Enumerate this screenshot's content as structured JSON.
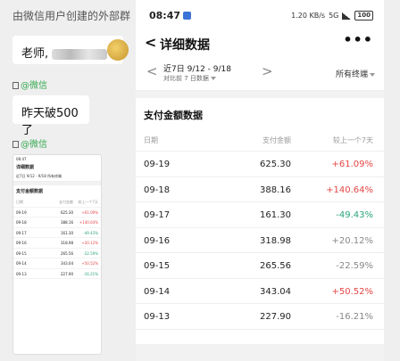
{
  "chat": {
    "header": "由微信用户创建的外部群",
    "msg1": "老师,",
    "source_label": "@微信",
    "msg2": "昨天破500了"
  },
  "thumbnail": {
    "time": "08:47",
    "title": "详细数据",
    "range": "近7日 9/12 - 9/18",
    "terminal": "所有终端",
    "section": "支付金额数据",
    "head": [
      "日期",
      "支付金额",
      "较上一个7天"
    ],
    "rows": [
      [
        "09-19",
        "625.30",
        "+61.09%"
      ],
      [
        "09-18",
        "388.16",
        "+140.64%"
      ],
      [
        "09-17",
        "161.30",
        "-49.43%"
      ],
      [
        "09-16",
        "318.98",
        "+20.12%"
      ],
      [
        "09-15",
        "265.56",
        "-22.59%"
      ],
      [
        "09-14",
        "343.04",
        "+50.52%"
      ],
      [
        "09-13",
        "227.90",
        "-16.21%"
      ]
    ]
  },
  "status": {
    "time": "08:47",
    "speed": "1.20 KB/s",
    "net": "5G",
    "battery": "100"
  },
  "nav": {
    "back": "<",
    "title": "详细数据",
    "more": "•••"
  },
  "range": {
    "prev": "<",
    "next": ">",
    "main": "近7日 9/12 - 9/18",
    "compare": "对比前 7 日数据",
    "terminal": "所有终端"
  },
  "card": {
    "title": "支付金额数据",
    "columns": [
      "日期",
      "支付金额",
      "较上一个7天"
    ],
    "rows": [
      {
        "date": "09-19",
        "amount": "625.30",
        "change": "+61.09%",
        "trend": "up"
      },
      {
        "date": "09-18",
        "amount": "388.16",
        "change": "+140.64%",
        "trend": "up"
      },
      {
        "date": "09-17",
        "amount": "161.30",
        "change": "-49.43%",
        "trend": "down"
      },
      {
        "date": "09-16",
        "amount": "318.98",
        "change": "+20.12%",
        "trend": "neutral"
      },
      {
        "date": "09-15",
        "amount": "265.56",
        "change": "-22.59%",
        "trend": "neutral"
      },
      {
        "date": "09-14",
        "amount": "343.04",
        "change": "+50.52%",
        "trend": "up"
      },
      {
        "date": "09-13",
        "amount": "227.90",
        "change": "-16.21%",
        "trend": "neutral"
      }
    ]
  },
  "colors": {
    "up": "#e64545",
    "down": "#2aa379",
    "neutral": "#888888",
    "wechat_green": "#36a852"
  }
}
